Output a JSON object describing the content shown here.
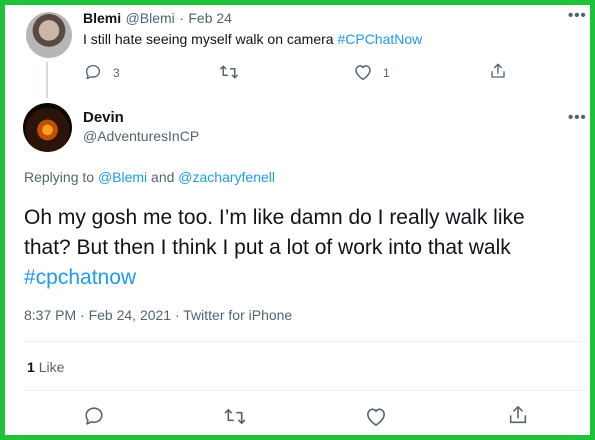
{
  "parent_tweet": {
    "name": "Blemi",
    "handle": "@Blemi",
    "separator": "·",
    "date": "Feb 24",
    "text": "I still hate seeing myself walk on camera ",
    "hashtag": "#CPChatNow",
    "reply_count": "3",
    "retweet_count": "",
    "like_count": "1",
    "more_icon": "more-horizontal-icon"
  },
  "main_tweet": {
    "name": "Devin",
    "handle": "@AdventuresInCP",
    "replying_prefix": "Replying to ",
    "replying_user_1": "@Blemi",
    "replying_and": " and ",
    "replying_user_2": "@zacharyfenell",
    "text_line_1": "Oh my gosh me too. I’m like damn do I really walk like",
    "text_line_2": "that? But then I think I put a lot of work into that walk",
    "hashtag": "#cpchatnow",
    "timestamp": "8:37 PM · Feb 24, 2021 · ",
    "source": "Twitter for iPhone",
    "like_count": "1",
    "like_label": "Like",
    "more_icon": "more-horizontal-icon"
  },
  "theme": {
    "border_color": "#1ec33a",
    "link_color": "#1d9bf0",
    "text_color": "#0f1419",
    "muted_color": "#536471"
  }
}
